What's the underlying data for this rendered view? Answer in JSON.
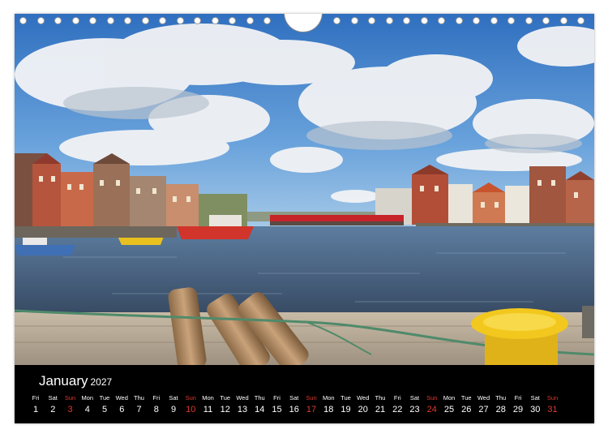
{
  "calendar": {
    "month": "January",
    "year": "2027",
    "days": [
      {
        "name": "Fri",
        "num": "1",
        "sunday": false
      },
      {
        "name": "Sat",
        "num": "2",
        "sunday": false
      },
      {
        "name": "Sun",
        "num": "3",
        "sunday": true
      },
      {
        "name": "Mon",
        "num": "4",
        "sunday": false
      },
      {
        "name": "Tue",
        "num": "5",
        "sunday": false
      },
      {
        "name": "Wed",
        "num": "6",
        "sunday": false
      },
      {
        "name": "Thu",
        "num": "7",
        "sunday": false
      },
      {
        "name": "Fri",
        "num": "8",
        "sunday": false
      },
      {
        "name": "Sat",
        "num": "9",
        "sunday": false
      },
      {
        "name": "Sun",
        "num": "10",
        "sunday": true
      },
      {
        "name": "Mon",
        "num": "11",
        "sunday": false
      },
      {
        "name": "Tue",
        "num": "12",
        "sunday": false
      },
      {
        "name": "Wed",
        "num": "13",
        "sunday": false
      },
      {
        "name": "Thu",
        "num": "14",
        "sunday": false
      },
      {
        "name": "Fri",
        "num": "15",
        "sunday": false
      },
      {
        "name": "Sat",
        "num": "16",
        "sunday": false
      },
      {
        "name": "Sun",
        "num": "17",
        "sunday": true
      },
      {
        "name": "Mon",
        "num": "18",
        "sunday": false
      },
      {
        "name": "Tue",
        "num": "19",
        "sunday": false
      },
      {
        "name": "Wed",
        "num": "20",
        "sunday": false
      },
      {
        "name": "Thu",
        "num": "21",
        "sunday": false
      },
      {
        "name": "Fri",
        "num": "22",
        "sunday": false
      },
      {
        "name": "Sat",
        "num": "23",
        "sunday": false
      },
      {
        "name": "Sun",
        "num": "24",
        "sunday": true
      },
      {
        "name": "Mon",
        "num": "25",
        "sunday": false
      },
      {
        "name": "Tue",
        "num": "26",
        "sunday": false
      },
      {
        "name": "Wed",
        "num": "27",
        "sunday": false
      },
      {
        "name": "Thu",
        "num": "28",
        "sunday": false
      },
      {
        "name": "Fri",
        "num": "29",
        "sunday": false
      },
      {
        "name": "Sat",
        "num": "30",
        "sunday": false
      },
      {
        "name": "Sun",
        "num": "31",
        "sunday": true
      }
    ]
  },
  "colors": {
    "band": "#000000",
    "text": "#ffffff",
    "sunday": "#e03a2e"
  },
  "photo": {
    "subject": "harbour-scene"
  }
}
